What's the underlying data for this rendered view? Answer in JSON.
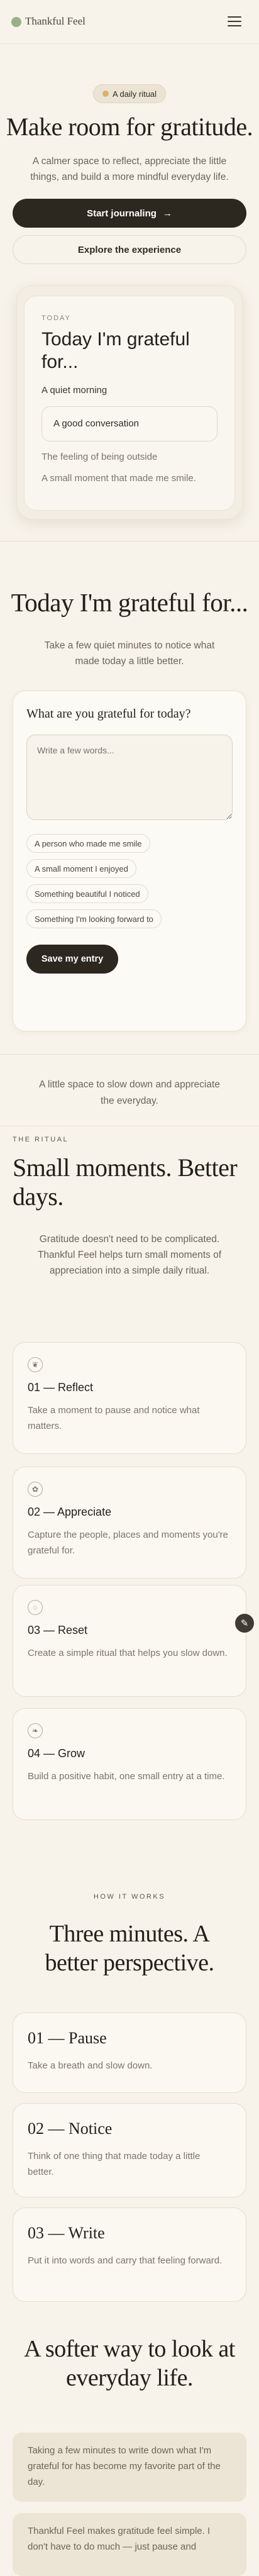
{
  "header": {
    "logo": "Thankful Feel",
    "menu_icon": "hamburger-menu-icon"
  },
  "hero": {
    "badge": "A daily ritual",
    "title": "Make room for gratitude.",
    "subtitle": "A calmer space to reflect, appreciate the little things, and build a more mindful everyday life.",
    "primary_cta": "Start journaling",
    "primary_cta_icon": "→",
    "secondary_cta": "Explore the experience"
  },
  "preview": {
    "eyebrow": "TODAY",
    "title": "Today I'm grateful for...",
    "prompt_1": "A quiet morning",
    "prompt_2": "A good conversation",
    "prompt_3": "The feeling of being outside",
    "prompt_4": "A small moment that made me smile."
  },
  "journal": {
    "title": "Today I'm grateful for...",
    "subtitle": "Take a few quiet minutes to notice what made today a little better.",
    "question": "What are you grateful for today?",
    "placeholder": "Write a few words...",
    "chips": [
      "A person who made me smile",
      "A small moment I enjoyed",
      "Something beautiful I noticed",
      "Something I'm looking forward to"
    ],
    "save_label": "Save my entry"
  },
  "slow_text": "A little space to slow down and appreciate the everyday.",
  "ritual": {
    "eyebrow": "THE RITUAL",
    "title": "Small moments. Better days.",
    "subtitle": "Gratitude doesn't need to be complicated. Thankful Feel helps turn small moments of appreciation into a simple daily ritual.",
    "cards": [
      {
        "icon": "leaf-icon",
        "glyph": "❦",
        "title": "01 — Reflect",
        "desc": "Take a moment to pause and notice what matters."
      },
      {
        "icon": "sprout-icon",
        "glyph": "✿",
        "title": "02 — Appreciate",
        "desc": "Capture the people, places and moments you're grateful for."
      },
      {
        "icon": "circle-icon",
        "glyph": "◌",
        "title": "03 — Reset",
        "desc": "Create a simple ritual that helps you slow down."
      },
      {
        "icon": "leaf-grow-icon",
        "glyph": "❧",
        "title": "04 — Grow",
        "desc": "Build a positive habit, one small entry at a time."
      }
    ],
    "floating_icon": "edit-icon"
  },
  "how": {
    "eyebrow": "HOW IT WORKS",
    "title": "Three minutes. A better perspective.",
    "steps": [
      {
        "title": "01 — Pause",
        "desc": "Take a breath and slow down."
      },
      {
        "title": "02 — Notice",
        "desc": "Think of one thing that made today a little better."
      },
      {
        "title": "03 — Write",
        "desc": "Put it into words and carry that feeling forward."
      }
    ]
  },
  "testimonials": {
    "title": "A softer way to look at everyday life.",
    "quotes": [
      "Taking a few minutes to write down what I'm grateful for has become my favorite part of the day.",
      "Thankful Feel makes gratitude feel simple. I don't have to do much — just pause and"
    ]
  },
  "colors": {
    "accent_dark": "#2c281f",
    "background": "#f7f3ea",
    "logo_green": "#9bb08a",
    "badge_gold": "#d8b26c"
  }
}
